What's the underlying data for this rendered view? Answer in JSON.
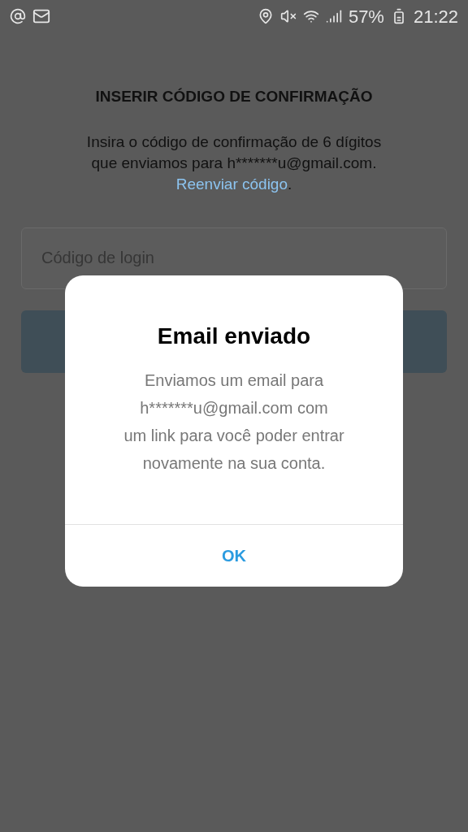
{
  "status_bar": {
    "battery": "57%",
    "time": "21:22"
  },
  "page": {
    "title": "INSERIR CÓDIGO DE CONFIRMAÇÃO",
    "instruction": "Insira o código de confirmação de 6 dígitos que enviamos para h*******u@gmail.com.",
    "resend_link": "Reenviar código",
    "instruction_end": ".",
    "code_field": {
      "placeholder": "Código de login"
    }
  },
  "dialog": {
    "title": "Email enviado",
    "body_lines": [
      "Enviamos um email para",
      "h*******u@gmail.com com",
      "um link para você poder entrar",
      "novamente na sua conta."
    ],
    "button": "OK"
  }
}
